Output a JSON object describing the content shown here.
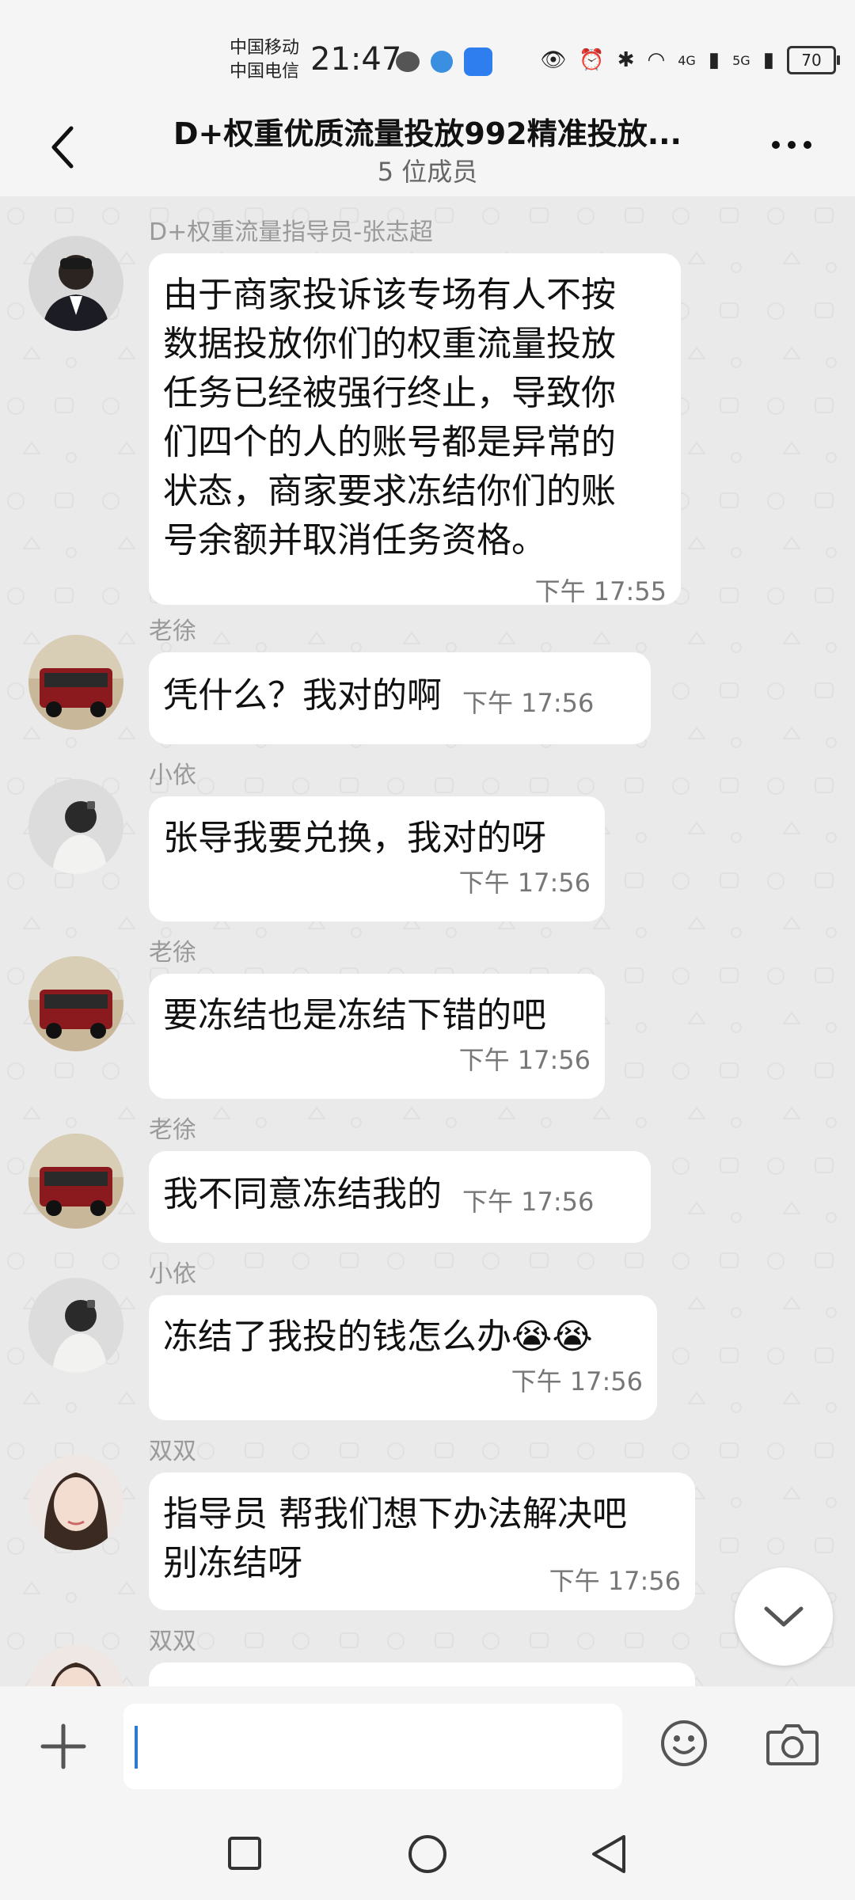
{
  "status_bar": {
    "carrier1": "中国移动",
    "carrier2": "中国电信",
    "time": "21:47",
    "net1": "4G",
    "net2": "5G",
    "battery": "70"
  },
  "header": {
    "title": "D+权重优质流量投放992精准投放...",
    "subtitle": "5 位成员"
  },
  "messages": [
    {
      "sender": "D+权重流量指导员-张志超",
      "text": "由于商家投诉该专场有人不按\n数据投放你们的权重流量投放\n任务已经被强行终止，导致你\n们四个的人的账号都是异常的\n状态，商家要求冻结你们的账\n号余额并取消任务资格。",
      "time": "下午 17:55"
    },
    {
      "sender": "老徐",
      "text": "凭什么？我对的啊",
      "time": "下午 17:56"
    },
    {
      "sender": "小依",
      "text": "张导我要兑换，我对的呀",
      "time": "下午 17:56"
    },
    {
      "sender": "老徐",
      "text": "要冻结也是冻结下错的吧",
      "time": "下午 17:56"
    },
    {
      "sender": "老徐",
      "text": "我不同意冻结我的",
      "time": "下午 17:56"
    },
    {
      "sender": "小依",
      "text": "冻结了我投的钱怎么办😭😭",
      "time": "下午 17:56"
    },
    {
      "sender": "双双",
      "text": "指导员 帮我们想下办法解决吧\n别冻结呀",
      "time": "下午 17:56"
    },
    {
      "sender": "双双",
      "text": "",
      "time": ""
    }
  ],
  "input": {
    "placeholder": ""
  },
  "icons": {
    "back": "chevron-left-icon",
    "more": "more-dots-icon",
    "plus": "plus-icon",
    "emoji": "emoji-icon",
    "camera": "camera-icon",
    "scroll_down": "chevron-down-icon"
  }
}
